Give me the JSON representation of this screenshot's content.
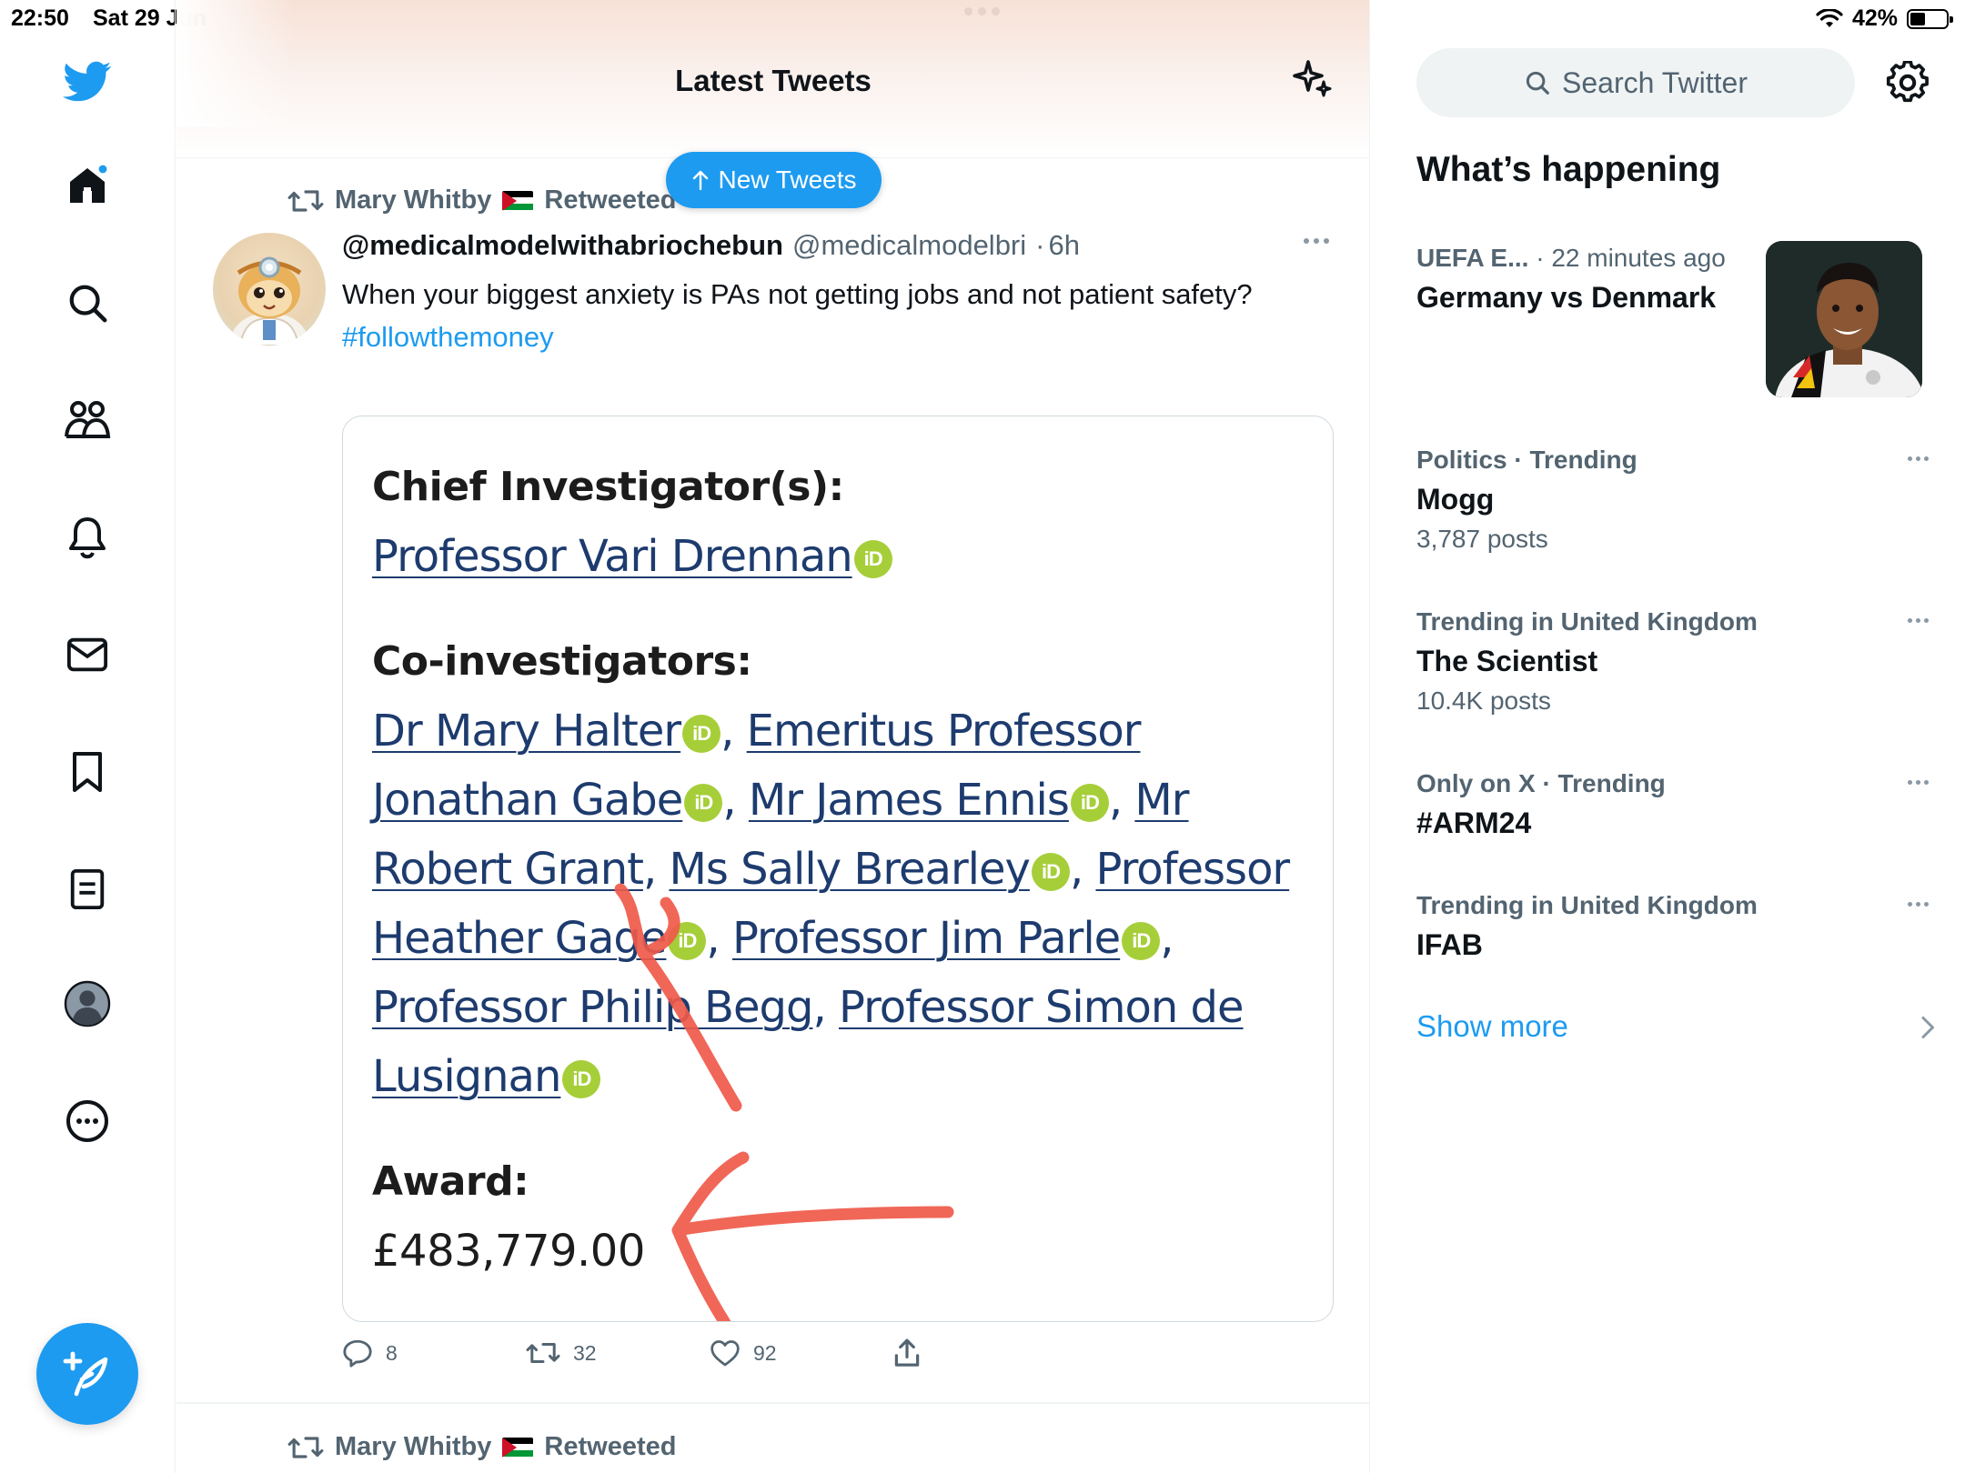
{
  "status_bar": {
    "time": "22:50",
    "date": "Sat 29 Jun",
    "battery": "42%",
    "battery_level_percent": 42
  },
  "nav": {
    "items": [
      "twitter-logo",
      "home-icon",
      "search-icon",
      "communities-icon",
      "notifications-icon",
      "messages-icon",
      "bookmarks-icon",
      "lists-icon",
      "profile-icon",
      "more-icon"
    ],
    "compose": "compose-tweet-icon"
  },
  "header": {
    "title": "Latest Tweets",
    "new_tweets_label": "New Tweets"
  },
  "tweet": {
    "retweeted_by": "Mary Whitby",
    "retweeted_label": "Retweeted",
    "display_name": "@medicalmodelwithabriochebun",
    "handle": "@medicalmodelbri",
    "time": "6h",
    "text": "When your biggest anxiety is PAs not getting jobs and not patient safety?",
    "hashtag": "#followthemoney",
    "image": {
      "chief_heading": "Chief Investigator(s):",
      "chief": "Professor Vari Drennan",
      "co_heading": "Co-investigators:",
      "co": [
        "Dr Mary Halter",
        "Emeritus Professor Jonathan Gabe",
        "Mr James Ennis",
        "Mr Robert Grant",
        "Ms Sally Brearley",
        "Professor Heather Gage",
        "Professor Jim Parle",
        "Professor Philip Begg",
        "Professor Simon de Lusignan"
      ],
      "award_heading": "Award:",
      "award": "£483,779.00",
      "orcid_label": "iD"
    },
    "replies": "8",
    "retweets": "32",
    "likes": "92"
  },
  "next_tweet": {
    "retweeted_by": "Mary Whitby",
    "retweeted_label": "Retweeted"
  },
  "sidebar": {
    "search_placeholder": "Search Twitter",
    "whats_happening": "What’s happening",
    "trends": [
      {
        "category": "UEFA E...",
        "detail": " · 22 minutes ago",
        "title": "Germany vs Denmark",
        "count": ""
      },
      {
        "category": "Politics · Trending",
        "detail": "",
        "title": "Mogg",
        "count": "3,787 posts"
      },
      {
        "category": "Trending in United Kingdom",
        "detail": "",
        "title": "The Scientist",
        "count": "10.4K posts"
      },
      {
        "category": "Only on X · Trending",
        "detail": "",
        "title": "#ARM24",
        "count": ""
      },
      {
        "category": "Trending in United Kingdom",
        "detail": "",
        "title": "IFAB",
        "count": ""
      }
    ],
    "show_more": "Show more"
  },
  "colors": {
    "accent": "#1d9bf0",
    "text": "#0f1419",
    "muted": "#536471",
    "orcid": "#a6ce39",
    "annotation": "#ef5a4a"
  }
}
